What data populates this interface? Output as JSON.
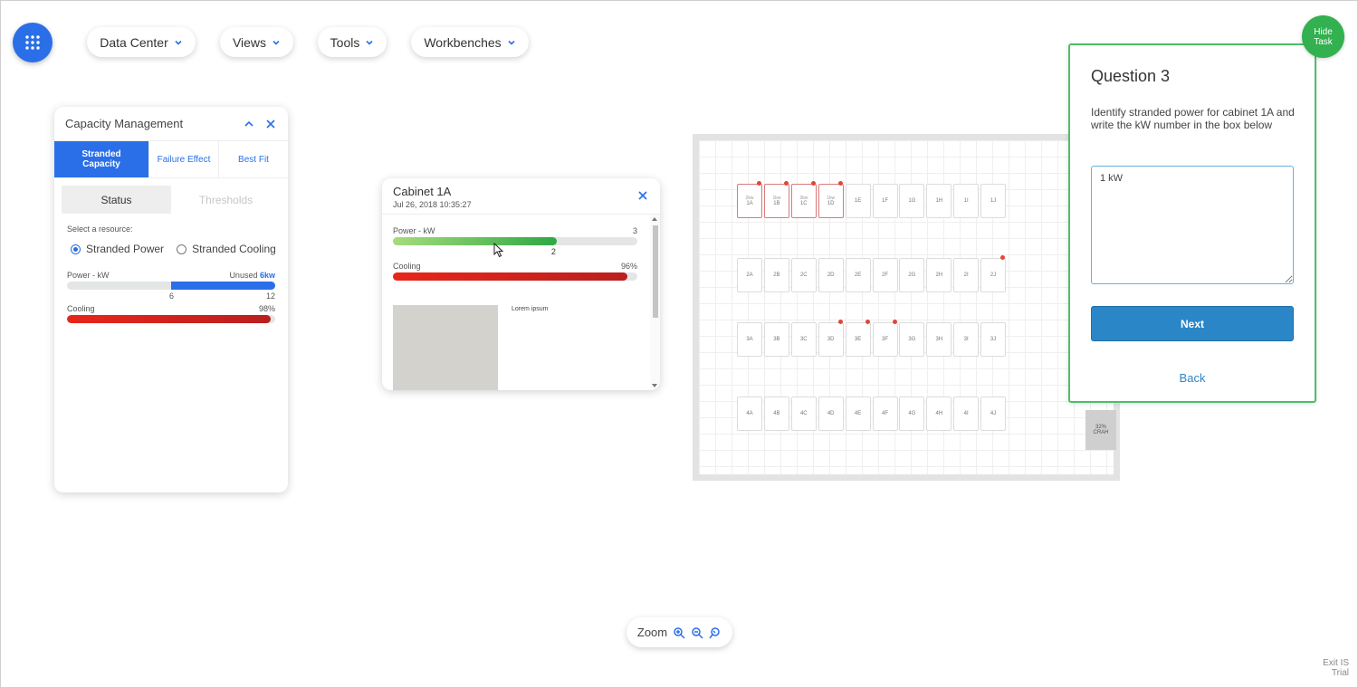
{
  "topbar": {
    "apps_icon": "grid-icon",
    "menus": [
      {
        "label": "Data Center"
      },
      {
        "label": "Views"
      },
      {
        "label": "Tools"
      },
      {
        "label": "Workbenches"
      }
    ]
  },
  "capacity": {
    "title": "Capacity Management",
    "tabs": [
      "Stranded Capacity",
      "Failure Effect",
      "Best Fit"
    ],
    "segments": [
      "Status",
      "Thresholds"
    ],
    "select_label": "Select a resource:",
    "radios": [
      "Stranded Power",
      "Stranded Cooling"
    ],
    "power": {
      "label": "Power - kW",
      "unused_label": "Unused",
      "unused_value": "6kw",
      "tick_mid": "6",
      "tick_max": "12",
      "unused_fraction": 0.5
    },
    "cooling": {
      "label": "Cooling",
      "value": "98%",
      "fraction": 0.98
    }
  },
  "cabinet": {
    "title": "Cabinet 1A",
    "date": "Jul 26, 2018 10:35:27",
    "power": {
      "label": "Power - kW",
      "max": "3",
      "marker": "2",
      "fraction": 0.67
    },
    "cooling": {
      "label": "Cooling",
      "value": "96%",
      "fraction": 0.96
    },
    "lorem": "Lorem ipsum"
  },
  "floor": {
    "rows": [
      [
        "1A",
        "1B",
        "1C",
        "1D",
        "1E",
        "1F",
        "1G",
        "1H",
        "1I",
        "1J"
      ],
      [
        "2A",
        "2B",
        "2C",
        "2D",
        "2E",
        "2F",
        "2G",
        "2H",
        "2I",
        "2J"
      ],
      [
        "3A",
        "3B",
        "3C",
        "3D",
        "3E",
        "3F",
        "3G",
        "3H",
        "3I",
        "3J"
      ],
      [
        "4A",
        "4B",
        "4C",
        "4D",
        "4E",
        "4F",
        "4G",
        "4H",
        "4I",
        "4J"
      ]
    ],
    "sub_labels": {
      "1A": "2kw",
      "1B": "1kw",
      "1C": "2kw",
      "1D": "1kw"
    },
    "crah": {
      "pct": "32%",
      "label": "CRAH"
    }
  },
  "question": {
    "title": "Question 3",
    "text": "Identify stranded power for cabinet 1A and write the kW number in the box below",
    "answer": "1 kW",
    "next": "Next",
    "back": "Back"
  },
  "hide_task": {
    "line1": "Hide",
    "line2": "Task"
  },
  "zoom": {
    "label": "Zoom"
  },
  "exit": {
    "line1": "Exit IS",
    "line2": "Trial"
  },
  "colors": {
    "accent": "#2a6fe8",
    "green": "#33b04f",
    "red": "#d42a1e"
  }
}
